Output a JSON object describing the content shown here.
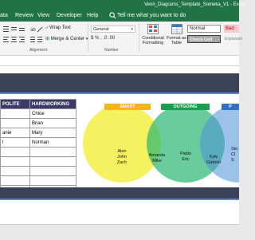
{
  "app": {
    "window_title": "Venn_Diagrams_Template_Someka_V1  -  Excel"
  },
  "tabs": [
    "ata",
    "Review",
    "View",
    "Developer",
    "Help"
  ],
  "search": {
    "placeholder": "Tell me what you want to do"
  },
  "ribbon": {
    "wrap_text": "Wrap Text",
    "merge_center": "Merge & Center",
    "number_format": "General",
    "number_symbols": "$  %  ,  .0  .00",
    "conditional_formatting": [
      "Conditional",
      "Formatting"
    ],
    "format_as_table": [
      "Format as",
      "Table"
    ],
    "styles": {
      "normal": "Normal",
      "bad": "Bad",
      "check_cell": "Check Cell",
      "explanatory": "Explanato"
    },
    "group_alignment": "Alignment",
    "group_number": "Number"
  },
  "table": {
    "headers": [
      "POLITE",
      "HARDWORKING"
    ],
    "rows": [
      [
        "",
        "Chloe"
      ],
      [
        "",
        "Brian"
      ],
      [
        "anie",
        "Mary"
      ],
      [
        "l",
        "Norman"
      ],
      [
        "",
        ""
      ],
      [
        "",
        ""
      ],
      [
        "",
        ""
      ],
      [
        "",
        ""
      ],
      [
        "",
        ""
      ],
      [
        "",
        ""
      ]
    ]
  },
  "venn": {
    "labels": {
      "smart": "SMART",
      "outgoing": "OUTGOING",
      "third": "P"
    },
    "groups": {
      "smart_only": "Alen\nJohn\nZach",
      "smart_outgoing": "Amanda\nMike",
      "outgoing_only": "Pablo\nEric",
      "outgoing_third": "Kyle\nGabriel",
      "third_only": "Sto\nCl\nS"
    },
    "colors": {
      "smart": "#f4ee43",
      "outgoing": "#2bb673",
      "third": "#4a90d9",
      "header": "#3b3a6b",
      "band": "#3b4258",
      "excel": "#217346"
    }
  }
}
